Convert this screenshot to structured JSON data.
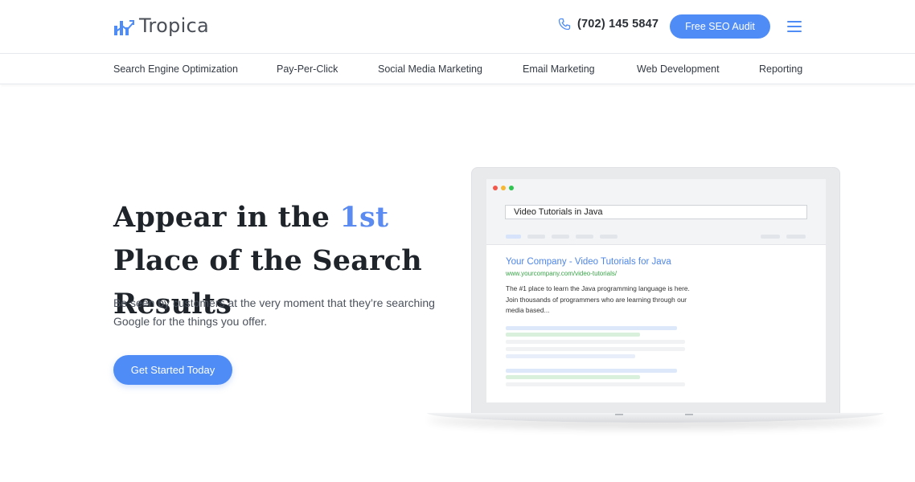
{
  "header": {
    "brand": "Tropica",
    "phone": "(702) 145 5847",
    "audit_label": "Free SEO Audit",
    "accent": "#4f8cf5"
  },
  "nav": {
    "items": [
      {
        "label": "Search Engine Optimization"
      },
      {
        "label": "Pay-Per-Click"
      },
      {
        "label": "Social Media Marketing"
      },
      {
        "label": "Email Marketing"
      },
      {
        "label": "Web Development"
      },
      {
        "label": "Reporting"
      }
    ]
  },
  "hero": {
    "title_part1": "Appear in the ",
    "title_highlight": "1st",
    "title_part2": " Place of the Search Results",
    "subtitle": "Be seen by customers at the very moment that they’re searching Google for the things you offer.",
    "cta_label": "Get Started Today"
  },
  "mockup": {
    "search_query": "Video Tutorials in Java",
    "result_title": "Your Company - Video Tutorials for Java",
    "result_url": "www.yourcompany.com/video-tutorials/",
    "result_description": "The #1 place to learn the Java programming language is here. Join thousands of programmers who are learning through our media based...",
    "window_dots": [
      "#f4574a",
      "#f7b731",
      "#2fc550"
    ]
  }
}
